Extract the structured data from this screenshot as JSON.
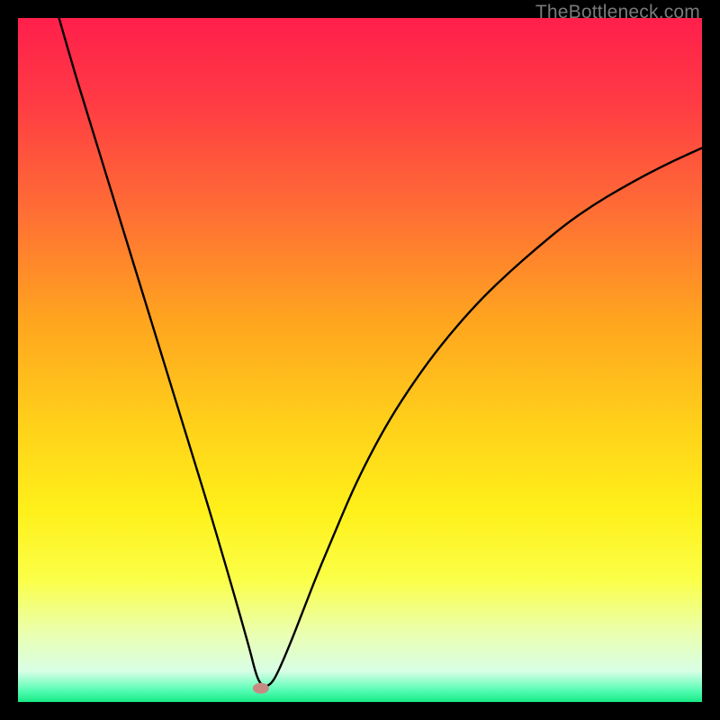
{
  "watermark": "TheBottleneck.com",
  "chart_data": {
    "type": "line",
    "title": "",
    "xlabel": "",
    "ylabel": "",
    "xlim": [
      0,
      100
    ],
    "ylim": [
      0,
      100
    ],
    "background_gradient": {
      "stops": [
        {
          "offset": 0.0,
          "color": "#ff1f4b"
        },
        {
          "offset": 0.12,
          "color": "#ff3a44"
        },
        {
          "offset": 0.28,
          "color": "#ff6d35"
        },
        {
          "offset": 0.44,
          "color": "#ffa41f"
        },
        {
          "offset": 0.6,
          "color": "#ffd21a"
        },
        {
          "offset": 0.72,
          "color": "#fff01a"
        },
        {
          "offset": 0.82,
          "color": "#fbff47"
        },
        {
          "offset": 0.9,
          "color": "#eaffb0"
        },
        {
          "offset": 0.955,
          "color": "#d8ffe6"
        },
        {
          "offset": 0.985,
          "color": "#4efcb0"
        },
        {
          "offset": 1.0,
          "color": "#17e884"
        }
      ]
    },
    "marker": {
      "x": 35.5,
      "y": 2.0,
      "color": "#c78a82",
      "rx": 9,
      "ry": 6
    },
    "series": [
      {
        "name": "bottleneck-curve",
        "color": "#000000",
        "x": [
          6,
          8,
          10,
          12,
          14,
          16,
          18,
          20,
          22,
          24,
          26,
          28,
          30,
          31,
          32,
          33,
          34,
          34.6,
          35.2,
          36,
          37,
          38,
          40,
          42,
          44,
          46,
          48,
          50,
          53,
          56,
          60,
          64,
          68,
          72,
          76,
          80,
          84,
          88,
          92,
          96,
          100
        ],
        "y": [
          100,
          93,
          86.5,
          80,
          73.5,
          67,
          60.5,
          54,
          47.5,
          41,
          34.5,
          28,
          21.2,
          17.8,
          14.3,
          10.8,
          7.2,
          4.8,
          3.0,
          2.2,
          2.6,
          4.3,
          9.0,
          14.2,
          19.3,
          24.0,
          28.8,
          33.2,
          39.0,
          44.0,
          49.8,
          54.8,
          59.2,
          63.0,
          66.5,
          69.8,
          72.6,
          75.0,
          77.2,
          79.2,
          81.0
        ]
      }
    ]
  }
}
